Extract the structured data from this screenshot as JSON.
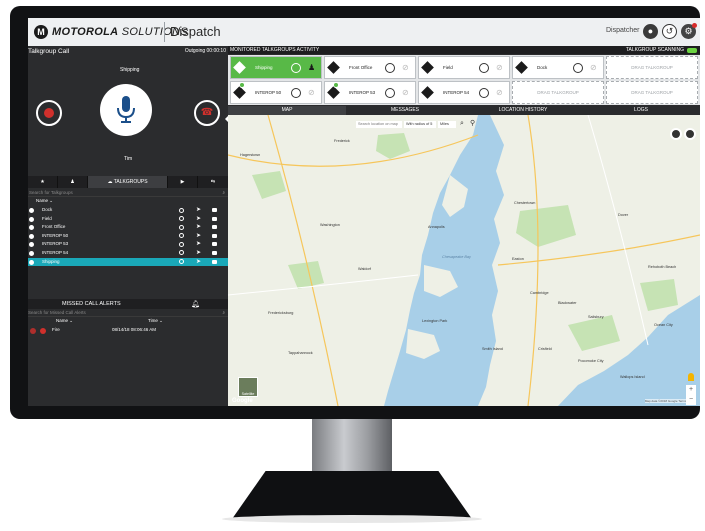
{
  "header": {
    "logo_letter": "M",
    "brand_bold": "MOTOROLA",
    "brand_light": " SOLUTIONS",
    "app_title": "Dispatch",
    "user": "Dispatcher"
  },
  "call": {
    "title": "Talkgroup Call",
    "outgoing": "Outgoing 00:00:10",
    "status": "Shipping",
    "caller": "Tim"
  },
  "left_tabs": [
    {
      "label": "★"
    },
    {
      "label": "♟"
    },
    {
      "label": "☁ TALKGROUPS"
    },
    {
      "label": "▶"
    },
    {
      "label": "⇆"
    }
  ],
  "talkgroups": {
    "search_placeholder": "Search for Talkgroups",
    "col_name": "Name ⌄",
    "items": [
      {
        "label": "Dock"
      },
      {
        "label": "Field"
      },
      {
        "label": "Front Office"
      },
      {
        "label": "INTEROP 50"
      },
      {
        "label": "INTEROP 53"
      },
      {
        "label": "INTEROP 54"
      },
      {
        "label": "Shipping"
      }
    ]
  },
  "missed_alerts": {
    "title": "MISSED CALL ALERTS",
    "search_placeholder": "Search for Missed Call Alerts",
    "col_name": "Name ⌄",
    "col_time": "Time ⌄",
    "rows": [
      {
        "name": "Fire",
        "time": "08/14/18 08:06:46 AM"
      }
    ]
  },
  "monitored": {
    "title": "MONITORED TALKGROUPS ACTIVITY",
    "scanning": "TALKGROUP SCANNING",
    "tiles": [
      {
        "name": "Shipping"
      },
      {
        "name": "Front Office"
      },
      {
        "name": "Field"
      },
      {
        "name": "Dock"
      },
      {
        "name": "DRAG TALKGROUP"
      },
      {
        "name": "INTEROP 50"
      },
      {
        "name": "INTEROP 53"
      },
      {
        "name": "INTEROP 54"
      },
      {
        "name": "DRAG TALKGROUP"
      },
      {
        "name": "DRAG TALKGROUP"
      }
    ]
  },
  "map_tabs": [
    {
      "label": "MAP"
    },
    {
      "label": "MESSAGES"
    },
    {
      "label": "LOCATION HISTORY"
    },
    {
      "label": "LOGS"
    }
  ],
  "map": {
    "search_placeholder": "Search location on map",
    "radius": "With radius of 5",
    "units": "Miles",
    "satellite": "Satellite",
    "google": "Google",
    "copyright": "Map data ©2018 Google   Terms of Use",
    "labels": {
      "frederick": "Frederick",
      "hagerstown": "Hagerstown",
      "cambridge": "Cambridge",
      "chestertown": "Chestertown",
      "annapolis": "Annapolis",
      "easton": "Easton",
      "dover": "Dover",
      "salisbury": "Salisbury",
      "ocean_city": "Ocean City",
      "washington": "Washington",
      "waldorf": "Waldorf",
      "lexington": "Lexington Park",
      "blackwater": "Blackwater",
      "chesapeake": "Chesapeake Bay",
      "fredericksburg": "Fredericksburg",
      "tappahannock": "Tappahannock",
      "rehoboth": "Rehoboth Beach",
      "wallops": "Wallops Island",
      "smith_island": "Smith Island",
      "crisfield": "Crisfield",
      "pocomoke": "Pocomoke City"
    }
  }
}
